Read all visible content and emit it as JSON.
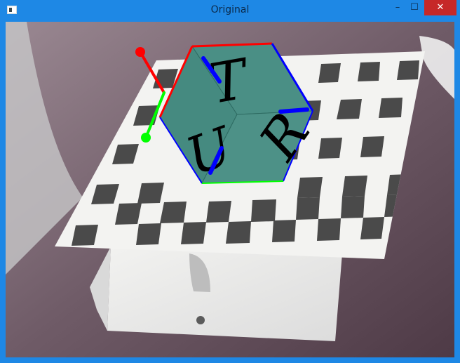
{
  "window": {
    "title": "Original",
    "controls": {
      "minimize_glyph": "–",
      "maximize_glyph": "☐",
      "close_glyph": "✕"
    }
  },
  "scene": {
    "cube_letters": {
      "top": "T",
      "front": "U",
      "right": "R"
    },
    "colors": {
      "cube_face": "#4a8f85",
      "axis_x": "#ff0000",
      "axis_y": "#00ff00",
      "axis_z": "#0000ff"
    }
  }
}
